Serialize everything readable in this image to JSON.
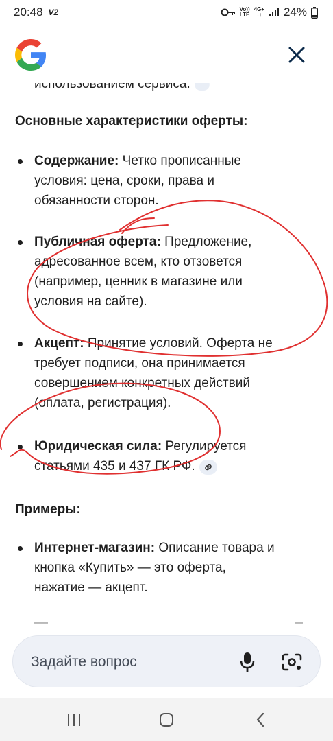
{
  "status_bar": {
    "time": "20:48",
    "carrier_tag": "V2",
    "volte_top": "Vo))",
    "volte_bottom": "LTE",
    "network": "4G+",
    "battery": "24%"
  },
  "header": {
    "logo_alt": "Google",
    "icons": [
      "google-logo",
      "close-icon"
    ]
  },
  "article": {
    "cut_text": "использованием сервиса.",
    "section1_heading": "Основные характеристики оферты:",
    "bullets": [
      {
        "bold": "Содержание:",
        "lines": [
          "Четко прописанные",
          "условия: цена, сроки, права и",
          "обязанности сторон."
        ]
      },
      {
        "bold": "Публичная оферта:",
        "lines": [
          "Предложение,",
          "адресованное всем, кто отзовется",
          "(например, ценник в магазине или",
          "условия на сайте)."
        ]
      },
      {
        "bold": "Акцепт:",
        "lines": [
          "Принятие условий. Оферта не",
          "требует подписи, она принимается",
          "совершением конкретных действий",
          "(оплата, регистрация)."
        ]
      },
      {
        "bold": "Юридическая сила:",
        "lines": [
          "Регулируется",
          "статьями 435 и 437 ГК РФ."
        ]
      }
    ],
    "section2_heading": "Примеры:",
    "examples": [
      {
        "bold": "Интернет-магазин:",
        "lines": [
          "Описание товара и",
          "кнопка «Купить» — это оферта,",
          "нажатие — акцепт."
        ]
      }
    ]
  },
  "ask": {
    "placeholder": "Задайте вопрос",
    "icons": [
      "mic-icon",
      "lens-icon"
    ]
  },
  "nav": {
    "icons": [
      "recents-icon",
      "home-icon",
      "back-icon"
    ]
  },
  "colors": {
    "text": "#1f1f1f",
    "ink_annotation": "#e03030",
    "close_icon": "#0b2a4a",
    "ask_bg": "#eef1f7",
    "chip_bg": "#e9eef6"
  }
}
